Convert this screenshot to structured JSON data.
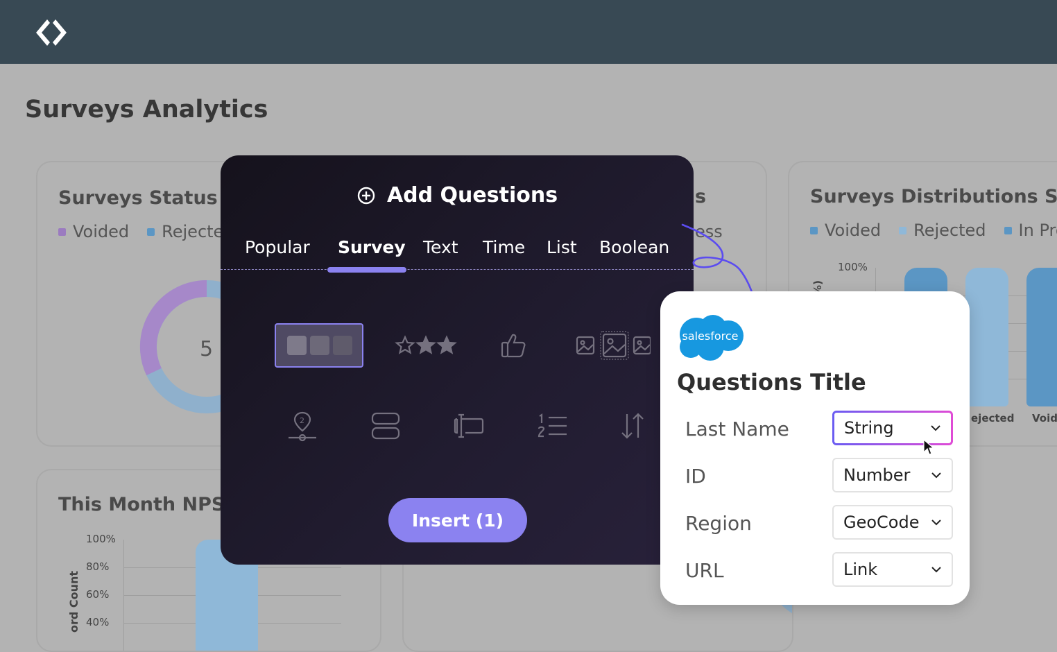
{
  "header": {
    "logo_icon": "angle-brackets-logo-icon"
  },
  "page": {
    "title": "Surveys Analytics"
  },
  "status_card": {
    "title": "Surveys Status",
    "legend": [
      {
        "label": "Voided",
        "color": "#9b7bc0"
      },
      {
        "label": "Rejecte",
        "color": "#5b96c4"
      }
    ],
    "donut_center_value": "5"
  },
  "middle_card": {
    "title_fragment": "s",
    "legend_fragment": "ess"
  },
  "distribution_card": {
    "title": "Surveys  Distributions Sta",
    "legend": [
      {
        "label": "Voided",
        "color": "#5b96c4"
      },
      {
        "label": "Rejected",
        "color": "#8fb8d8"
      },
      {
        "label": "In Pro",
        "color": "#5b96c4"
      }
    ]
  },
  "nps_card": {
    "title": "This Month NPS",
    "ylabel": "ord Count"
  },
  "chart_data": [
    {
      "type": "bar",
      "title": "Surveys  Distributions Sta",
      "ylabel": "%)",
      "y_ticks": [
        "100%"
      ],
      "categories": [
        "",
        "Rejected",
        "Voided"
      ],
      "category_labels_visible": [
        "",
        "ejected",
        "Voide"
      ],
      "values": [
        100,
        100,
        100
      ],
      "ylim": [
        0,
        100
      ]
    },
    {
      "type": "bar",
      "title": "This Month NPS",
      "ylabel": "ord Count",
      "y_ticks": [
        "100%",
        "80%",
        "60%",
        "40%"
      ],
      "categories": [
        ""
      ],
      "values": [
        100
      ],
      "ylim": [
        30,
        100
      ]
    }
  ],
  "dialog": {
    "title": "Add Questions",
    "title_icon": "plus-circle-icon",
    "tabs": [
      {
        "label": "Popular",
        "active": false
      },
      {
        "label": "Survey",
        "active": true
      },
      {
        "label": "Text",
        "active": false
      },
      {
        "label": "Time",
        "active": false
      },
      {
        "label": "List",
        "active": false
      },
      {
        "label": "Boolean",
        "active": false
      }
    ],
    "question_types": [
      {
        "icon": "multiple-choice-icon",
        "selected": true
      },
      {
        "icon": "star-rating-icon",
        "selected": false
      },
      {
        "icon": "thumbs-up-icon",
        "selected": false
      },
      {
        "icon": "image-choice-icon",
        "selected": false
      },
      {
        "icon": "location-pin-icon",
        "selected": false
      },
      {
        "icon": "stacked-rows-icon",
        "selected": false
      },
      {
        "icon": "text-input-icon",
        "selected": false
      },
      {
        "icon": "numbered-list-icon",
        "selected": false
      },
      {
        "icon": "sort-arrows-icon",
        "selected": false
      }
    ],
    "insert_label": "Insert (1)"
  },
  "salesforce_panel": {
    "brand": "salesforce",
    "title": "Questions Title",
    "fields": [
      {
        "label": "Last Name",
        "value": "String",
        "focused": true
      },
      {
        "label": "ID",
        "value": "Number",
        "focused": false
      },
      {
        "label": "Region",
        "value": "GeoCode",
        "focused": false
      },
      {
        "label": "URL",
        "value": "Link",
        "focused": false
      }
    ]
  }
}
